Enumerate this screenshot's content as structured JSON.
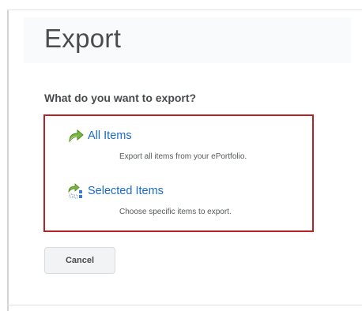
{
  "page": {
    "title": "Export",
    "question": "What do you want to export?"
  },
  "options": [
    {
      "label": "All Items",
      "description": "Export all items from your ePortfolio.",
      "icon": "export-all-icon"
    },
    {
      "label": "Selected Items",
      "description": "Choose specific items to export.",
      "icon": "export-selected-icon"
    }
  ],
  "actions": {
    "cancel_label": "Cancel"
  },
  "colors": {
    "link": "#1b6ac9",
    "highlight_border": "#b52226",
    "icon_green": "#6aa63a",
    "icon_blue": "#3a7bd5"
  }
}
